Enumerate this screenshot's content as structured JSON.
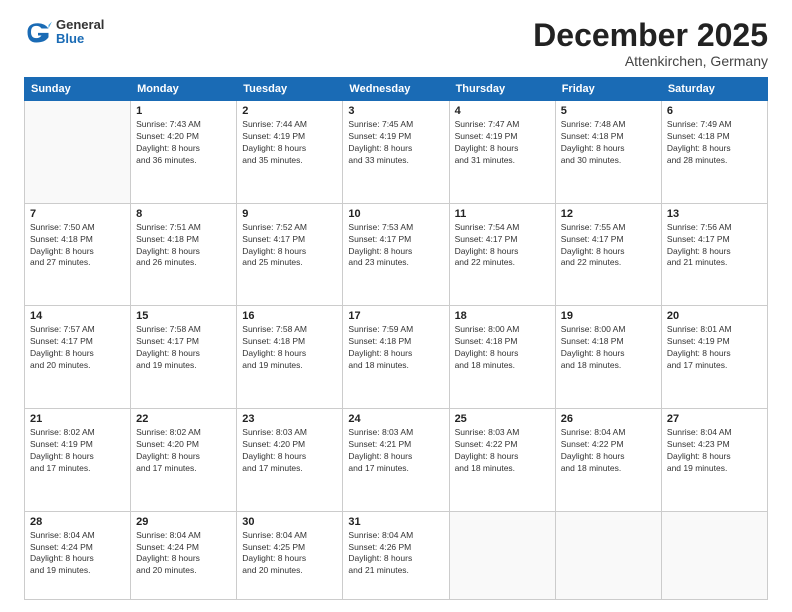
{
  "logo": {
    "general": "General",
    "blue": "Blue"
  },
  "header": {
    "month": "December 2025",
    "location": "Attenkirchen, Germany"
  },
  "weekdays": [
    "Sunday",
    "Monday",
    "Tuesday",
    "Wednesday",
    "Thursday",
    "Friday",
    "Saturday"
  ],
  "weeks": [
    [
      {
        "day": "",
        "info": ""
      },
      {
        "day": "1",
        "info": "Sunrise: 7:43 AM\nSunset: 4:20 PM\nDaylight: 8 hours\nand 36 minutes."
      },
      {
        "day": "2",
        "info": "Sunrise: 7:44 AM\nSunset: 4:19 PM\nDaylight: 8 hours\nand 35 minutes."
      },
      {
        "day": "3",
        "info": "Sunrise: 7:45 AM\nSunset: 4:19 PM\nDaylight: 8 hours\nand 33 minutes."
      },
      {
        "day": "4",
        "info": "Sunrise: 7:47 AM\nSunset: 4:19 PM\nDaylight: 8 hours\nand 31 minutes."
      },
      {
        "day": "5",
        "info": "Sunrise: 7:48 AM\nSunset: 4:18 PM\nDaylight: 8 hours\nand 30 minutes."
      },
      {
        "day": "6",
        "info": "Sunrise: 7:49 AM\nSunset: 4:18 PM\nDaylight: 8 hours\nand 28 minutes."
      }
    ],
    [
      {
        "day": "7",
        "info": "Sunrise: 7:50 AM\nSunset: 4:18 PM\nDaylight: 8 hours\nand 27 minutes."
      },
      {
        "day": "8",
        "info": "Sunrise: 7:51 AM\nSunset: 4:18 PM\nDaylight: 8 hours\nand 26 minutes."
      },
      {
        "day": "9",
        "info": "Sunrise: 7:52 AM\nSunset: 4:17 PM\nDaylight: 8 hours\nand 25 minutes."
      },
      {
        "day": "10",
        "info": "Sunrise: 7:53 AM\nSunset: 4:17 PM\nDaylight: 8 hours\nand 23 minutes."
      },
      {
        "day": "11",
        "info": "Sunrise: 7:54 AM\nSunset: 4:17 PM\nDaylight: 8 hours\nand 22 minutes."
      },
      {
        "day": "12",
        "info": "Sunrise: 7:55 AM\nSunset: 4:17 PM\nDaylight: 8 hours\nand 22 minutes."
      },
      {
        "day": "13",
        "info": "Sunrise: 7:56 AM\nSunset: 4:17 PM\nDaylight: 8 hours\nand 21 minutes."
      }
    ],
    [
      {
        "day": "14",
        "info": "Sunrise: 7:57 AM\nSunset: 4:17 PM\nDaylight: 8 hours\nand 20 minutes."
      },
      {
        "day": "15",
        "info": "Sunrise: 7:58 AM\nSunset: 4:17 PM\nDaylight: 8 hours\nand 19 minutes."
      },
      {
        "day": "16",
        "info": "Sunrise: 7:58 AM\nSunset: 4:18 PM\nDaylight: 8 hours\nand 19 minutes."
      },
      {
        "day": "17",
        "info": "Sunrise: 7:59 AM\nSunset: 4:18 PM\nDaylight: 8 hours\nand 18 minutes."
      },
      {
        "day": "18",
        "info": "Sunrise: 8:00 AM\nSunset: 4:18 PM\nDaylight: 8 hours\nand 18 minutes."
      },
      {
        "day": "19",
        "info": "Sunrise: 8:00 AM\nSunset: 4:18 PM\nDaylight: 8 hours\nand 18 minutes."
      },
      {
        "day": "20",
        "info": "Sunrise: 8:01 AM\nSunset: 4:19 PM\nDaylight: 8 hours\nand 17 minutes."
      }
    ],
    [
      {
        "day": "21",
        "info": "Sunrise: 8:02 AM\nSunset: 4:19 PM\nDaylight: 8 hours\nand 17 minutes."
      },
      {
        "day": "22",
        "info": "Sunrise: 8:02 AM\nSunset: 4:20 PM\nDaylight: 8 hours\nand 17 minutes."
      },
      {
        "day": "23",
        "info": "Sunrise: 8:03 AM\nSunset: 4:20 PM\nDaylight: 8 hours\nand 17 minutes."
      },
      {
        "day": "24",
        "info": "Sunrise: 8:03 AM\nSunset: 4:21 PM\nDaylight: 8 hours\nand 17 minutes."
      },
      {
        "day": "25",
        "info": "Sunrise: 8:03 AM\nSunset: 4:22 PM\nDaylight: 8 hours\nand 18 minutes."
      },
      {
        "day": "26",
        "info": "Sunrise: 8:04 AM\nSunset: 4:22 PM\nDaylight: 8 hours\nand 18 minutes."
      },
      {
        "day": "27",
        "info": "Sunrise: 8:04 AM\nSunset: 4:23 PM\nDaylight: 8 hours\nand 19 minutes."
      }
    ],
    [
      {
        "day": "28",
        "info": "Sunrise: 8:04 AM\nSunset: 4:24 PM\nDaylight: 8 hours\nand 19 minutes."
      },
      {
        "day": "29",
        "info": "Sunrise: 8:04 AM\nSunset: 4:24 PM\nDaylight: 8 hours\nand 20 minutes."
      },
      {
        "day": "30",
        "info": "Sunrise: 8:04 AM\nSunset: 4:25 PM\nDaylight: 8 hours\nand 20 minutes."
      },
      {
        "day": "31",
        "info": "Sunrise: 8:04 AM\nSunset: 4:26 PM\nDaylight: 8 hours\nand 21 minutes."
      },
      {
        "day": "",
        "info": ""
      },
      {
        "day": "",
        "info": ""
      },
      {
        "day": "",
        "info": ""
      }
    ]
  ]
}
